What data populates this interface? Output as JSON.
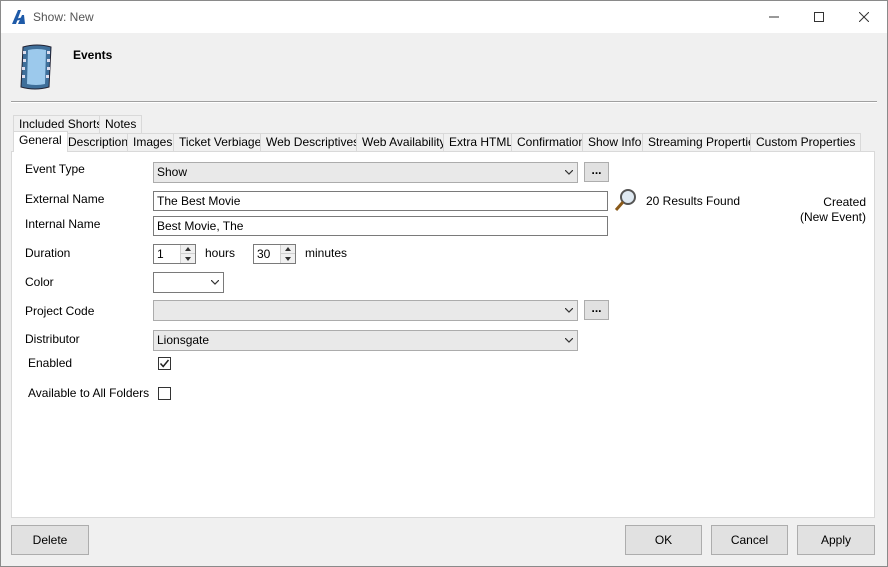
{
  "window": {
    "title": "Show: New",
    "header_title": "Events"
  },
  "tabs_row1": [
    {
      "label": "Included Shorts"
    },
    {
      "label": "Notes"
    }
  ],
  "tabs_row2": [
    {
      "label": "General",
      "active": true
    },
    {
      "label": "Description"
    },
    {
      "label": "Images"
    },
    {
      "label": "Ticket Verbiage"
    },
    {
      "label": "Web Descriptives"
    },
    {
      "label": "Web Availability"
    },
    {
      "label": "Extra HTML"
    },
    {
      "label": "Confirmation"
    },
    {
      "label": "Show Info"
    },
    {
      "label": "Streaming Properties"
    },
    {
      "label": "Custom Properties"
    }
  ],
  "form": {
    "event_type_label": "Event Type",
    "event_type_value": "Show",
    "external_name_label": "External Name",
    "external_name_value": "The Best Movie",
    "results_found": "20 Results Found",
    "internal_name_label": "Internal Name",
    "internal_name_value": "Best Movie, The",
    "duration_label": "Duration",
    "duration_hours": "1",
    "hours_label": "hours",
    "duration_minutes": "30",
    "minutes_label": "minutes",
    "color_label": "Color",
    "color_value": "",
    "project_code_label": "Project Code",
    "project_code_value": "",
    "distributor_label": "Distributor",
    "distributor_value": "Lionsgate",
    "enabled_label": "Enabled",
    "enabled_checked": true,
    "available_all_label": "Available to All Folders",
    "available_all_checked": false,
    "dots_label": "...",
    "created_label": "Created",
    "created_value": "(New Event)"
  },
  "buttons": {
    "delete": "Delete",
    "ok": "OK",
    "cancel": "Cancel",
    "apply": "Apply"
  },
  "colors": {
    "accent": "#2b6cb0",
    "panel_bg": "#ffffff",
    "window_bg": "#f0f0f0"
  }
}
